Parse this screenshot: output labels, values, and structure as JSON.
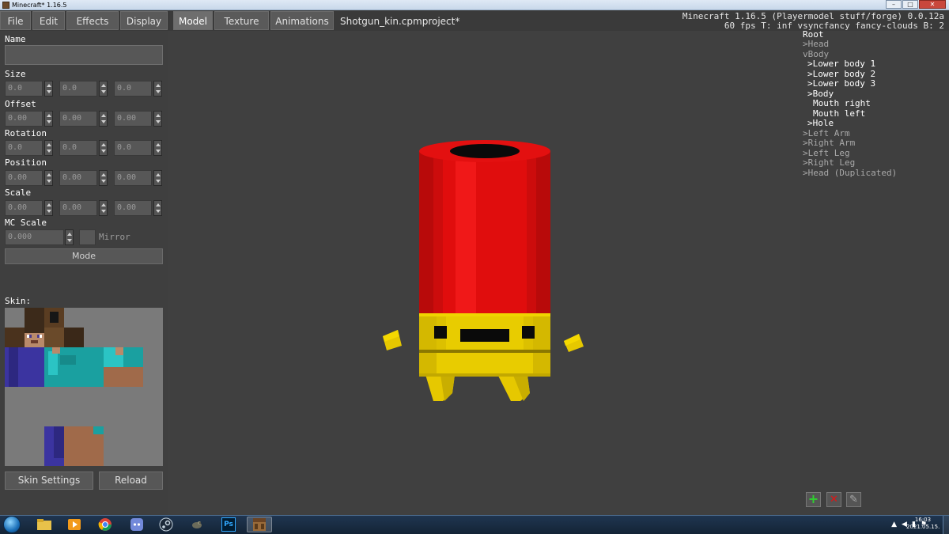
{
  "window": {
    "title": "Minecraft* 1.16.5",
    "buttons": {
      "minimize": "–",
      "maximize": "□",
      "close": "✕"
    }
  },
  "menu": {
    "items": [
      "File",
      "Edit",
      "Effects",
      "Display"
    ],
    "tabs": [
      "Model",
      "Texture",
      "Animations"
    ],
    "active_tab": "Model",
    "project_file": "Shotgun_kin.cpmproject*"
  },
  "debug_info": {
    "line1": "Minecraft 1.16.5 (Playermodel stuff/forge) 0.0.12a",
    "line2": "60 fps T: inf vsyncfancy fancy-clouds B: 2"
  },
  "properties": {
    "name_label": "Name",
    "name_value": "",
    "size": {
      "label": "Size",
      "values": [
        "0.0",
        "0.0",
        "0.0"
      ]
    },
    "offset": {
      "label": "Offset",
      "values": [
        "0.00",
        "0.00",
        "0.00"
      ]
    },
    "rotation": {
      "label": "Rotation",
      "values": [
        "0.0",
        "0.0",
        "0.0"
      ]
    },
    "position": {
      "label": "Position",
      "values": [
        "0.00",
        "0.00",
        "0.00"
      ]
    },
    "scale": {
      "label": "Scale",
      "values": [
        "0.00",
        "0.00",
        "0.00"
      ]
    },
    "mc_scale": {
      "label": "MC Scale",
      "value": "0.000"
    },
    "mirror_label": "Mirror",
    "mode_button": "Mode"
  },
  "skin": {
    "label": "Skin:",
    "settings_button": "Skin Settings",
    "reload_button": "Reload"
  },
  "tree": {
    "items": [
      {
        "label": "Root",
        "arrow": "",
        "state": "root"
      },
      {
        "label": "Head",
        "arrow": ">",
        "state": "dim"
      },
      {
        "label": "Body",
        "arrow": "v",
        "state": "dim"
      },
      {
        "label": "Lower body 1",
        "arrow": ">",
        "state": "normal"
      },
      {
        "label": "Lower body 2",
        "arrow": ">",
        "state": "normal"
      },
      {
        "label": "Lower body 3",
        "arrow": ">",
        "state": "normal"
      },
      {
        "label": "Body",
        "arrow": ">",
        "state": "normal"
      },
      {
        "label": "Mouth right",
        "arrow": "",
        "state": "normal"
      },
      {
        "label": "Mouth left",
        "arrow": "",
        "state": "normal"
      },
      {
        "label": "Hole",
        "arrow": ">",
        "state": "normal"
      },
      {
        "label": "Left Arm",
        "arrow": ">",
        "state": "dim"
      },
      {
        "label": "Right Arm",
        "arrow": ">",
        "state": "dim"
      },
      {
        "label": "Left Leg",
        "arrow": ">",
        "state": "dim"
      },
      {
        "label": "Right Leg",
        "arrow": ">",
        "state": "dim"
      },
      {
        "label": "Head (Duplicated)",
        "arrow": ">",
        "state": "dim"
      }
    ],
    "add_icon": "+",
    "delete_icon": "✕",
    "edit_icon": "✎"
  },
  "colors": {
    "shell_red": "#e00d0d",
    "shell_brass": "#e6c800",
    "tree_normal": "#ffffff",
    "tree_dim": "#a9a9a9"
  },
  "taskbar": {
    "apps": [
      "explorer",
      "media-player",
      "chrome",
      "discord",
      "steam",
      "gimp",
      "Ps",
      "minecraft"
    ],
    "clock_time": "16:03",
    "clock_date": "2021.05.15."
  }
}
